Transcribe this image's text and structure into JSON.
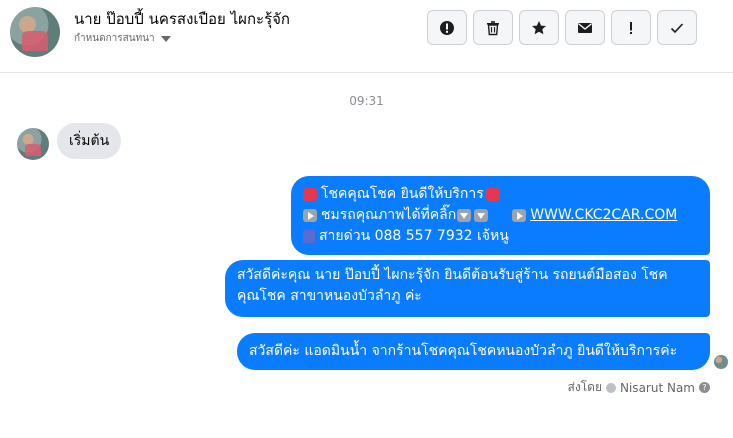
{
  "header": {
    "contact_name": "นาย ป๊อบปี้ นครสงเปือย ไผกะรุ้จัก",
    "assign_label": "กำหนดการสนทนา",
    "actions": [
      {
        "icon": "alert-circle-icon",
        "name": "mark-spam-button"
      },
      {
        "icon": "trash-icon",
        "name": "delete-button"
      },
      {
        "icon": "star-icon",
        "name": "star-button"
      },
      {
        "icon": "envelope-icon",
        "name": "mark-unread-button"
      },
      {
        "icon": "exclamation-icon",
        "name": "follow-up-button"
      },
      {
        "icon": "check-icon",
        "name": "mark-done-button"
      }
    ]
  },
  "conversation": {
    "timestamp": "09:31",
    "incoming": {
      "text": "เริ่มต้น"
    },
    "outgoing": {
      "m1": {
        "line1": "โชคคุณโชค ยินดีให้บริการ",
        "line2": "ชมรถคุณภาพได้ที่คลิ๊ก",
        "link": "WWW.CKC2CAR.COM",
        "line3": "สายด่วน 088 557 7932 เจ้หนู"
      },
      "m2": {
        "line1": "สวัสดีค่ะคุณ นาย ป๊อบปี้ ไผกะรุ้จัก ยินดีต้อนรับสู่ร้าน รถยนต์มือสอง โชค",
        "line2": "คุณโชค สาขาหนองบัวลำภู ค่ะ"
      },
      "m3": {
        "text": "สวัสดีค่ะ แอดมินน้ำ จากร้านโชคคุณโชคหนองบัวลำภู ยินดีให้บริการค่ะ"
      }
    },
    "sent_by": {
      "prefix": "ส่งโดย",
      "name": "Nisarut Nam"
    }
  },
  "colors": {
    "outgoing_bubble": "#0a7cff",
    "incoming_bubble": "#e4e6eb"
  }
}
